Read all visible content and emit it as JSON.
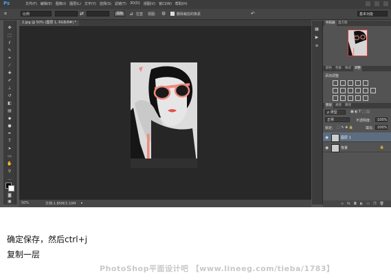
{
  "app": {
    "logo": "Ps",
    "menu": [
      "文件(F)",
      "编辑(E)",
      "图像(I)",
      "图层(L)",
      "文字(Y)",
      "选择(S)",
      "滤镜(T)",
      "3D(D)",
      "视图(V)",
      "窗口(W)",
      "帮助(H)"
    ]
  },
  "options_bar": {
    "ratio_label": "比例",
    "ratio_swap_icon": "swap-arrows-icon",
    "straighten_label": "拉直",
    "clear_label": "清除",
    "view_label": "视图:",
    "delete_cropped_label": "删除裁剪的像素",
    "workspace": "基本功能"
  },
  "document": {
    "tab_title": "2.jpg @ 50% (图层 1, RGB/8#) *",
    "zoom": "50%",
    "doc_size": "文档:1.85M/3.10M"
  },
  "panels": {
    "navigator_tabs": [
      "导航器",
      "直方图"
    ],
    "adjust_tabs": [
      "颜色",
      "色板",
      "样式",
      "调整"
    ],
    "adjust_title": "添加调整",
    "layers_tabs": [
      "图层",
      "通道",
      "路径"
    ],
    "layers": {
      "filter_kind": "ρ 类型",
      "blend_mode": "正常",
      "opacity_label": "不透明度:",
      "opacity_value": "100%",
      "lock_label": "锁定:",
      "fill_label": "填充:",
      "fill_value": "100%",
      "items": [
        {
          "name": "图层 1",
          "selected": true,
          "locked": false
        },
        {
          "name": "背景",
          "selected": false,
          "locked": true
        }
      ]
    }
  },
  "caption": {
    "line1": "确定保存，然后ctrl+j",
    "line2": "复制一层"
  },
  "watermark": "PhotoShop平面设计吧 【www.lineeg.com/tieba/1783】",
  "colors": {
    "accent_sunglasses": "#f08a7e",
    "selection_blue": "#5c6d80",
    "ps_logo": "#4fa3e8"
  }
}
